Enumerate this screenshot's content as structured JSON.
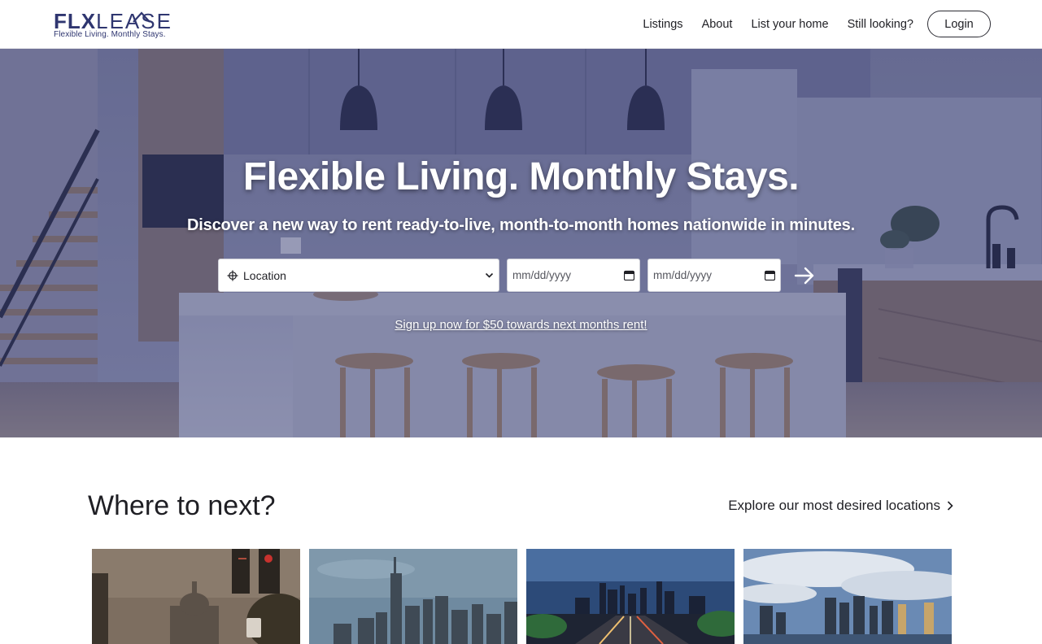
{
  "brand": {
    "name_bold": "FLX",
    "name_light": "LEASE",
    "tagline": "Flexible Living. Monthly Stays.",
    "color": "#2f3670"
  },
  "nav": {
    "items": [
      {
        "label": "Listings"
      },
      {
        "label": "About"
      },
      {
        "label": "List your home"
      },
      {
        "label": "Still looking?"
      }
    ],
    "login_label": "Login"
  },
  "hero": {
    "title": "Flexible Living. Monthly Stays.",
    "subtitle": "Discover a new way to rent ready-to-live, month-to-month homes nationwide in minutes.",
    "overlay_color": "#2e346e"
  },
  "search": {
    "location_value": "Location",
    "location_icon": "crosshair-icon",
    "start_date_placeholder": "mm/dd/yyyy",
    "end_date_placeholder": "mm/dd/yyyy",
    "submit_icon": "arrow-right-icon"
  },
  "promo": {
    "text": "Sign up now for $50 towards next months rent!"
  },
  "destinations": {
    "title": "Where to next?",
    "explore_label": "Explore our most desired locations",
    "cards": [
      {
        "name": "washington-dc",
        "icon": "capitol-photo"
      },
      {
        "name": "new-york",
        "icon": "skyline-photo"
      },
      {
        "name": "highway-city",
        "icon": "highway-photo"
      },
      {
        "name": "harbor-city",
        "icon": "harbor-photo"
      }
    ]
  }
}
